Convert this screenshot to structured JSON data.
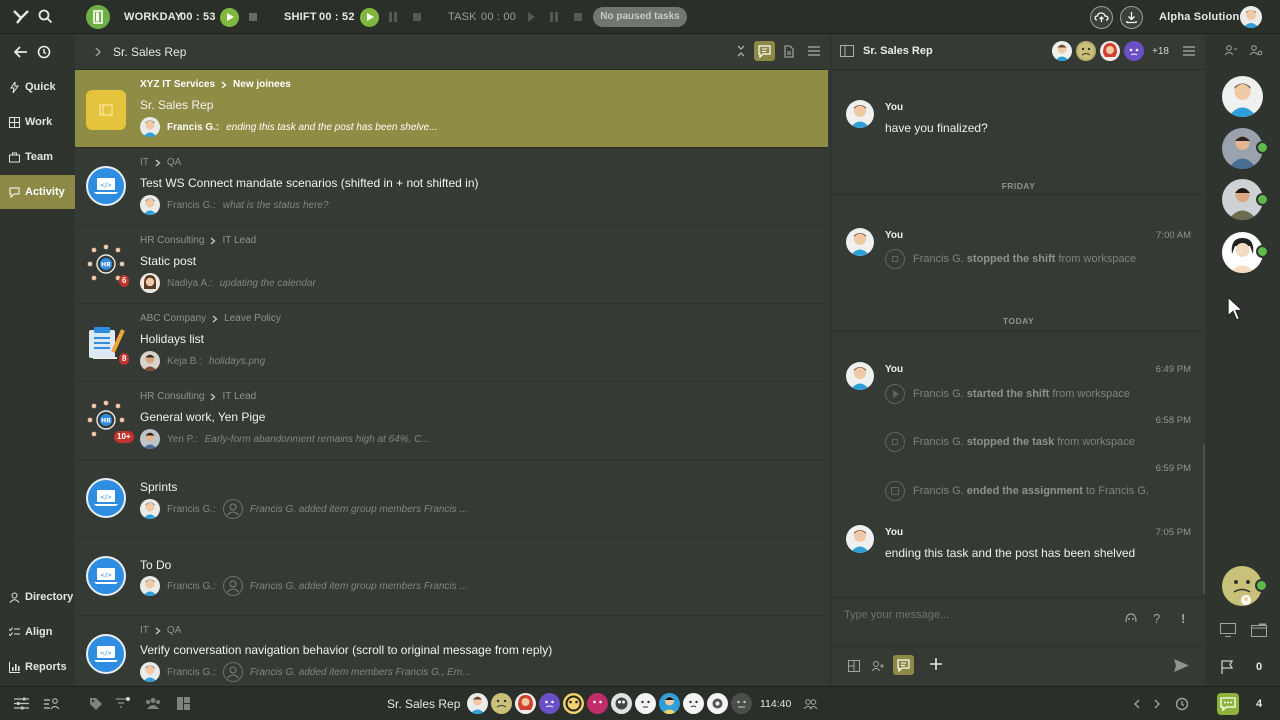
{
  "topbar": {
    "workday_label": "WORKDAY",
    "workday_time": "00 : 53",
    "shift_label": "SHIFT",
    "shift_time": "00 : 52",
    "task_label": "TASK",
    "task_time": "00 : 00",
    "paused_label": "No paused tasks",
    "org_name": "Alpha Solutions"
  },
  "nav": {
    "items": [
      {
        "label": "Quick",
        "icon": "lightning-icon"
      },
      {
        "label": "Work",
        "icon": "grid-icon"
      },
      {
        "label": "Team",
        "icon": "team-icon"
      },
      {
        "label": "Activity",
        "icon": "activity-icon"
      }
    ],
    "bottom_items": [
      {
        "label": "Directory",
        "icon": "directory-icon"
      },
      {
        "label": "Align",
        "icon": "align-icon"
      },
      {
        "label": "Reports",
        "icon": "reports-icon"
      }
    ]
  },
  "list": {
    "header_title": "Sr. Sales Rep",
    "rows": [
      {
        "bread": [
          "XYZ IT Services",
          "New joinees"
        ],
        "title": "Sr. Sales Rep",
        "author": "Francis G.:",
        "text": "ending this task and the post has been shelve...",
        "badge": ""
      },
      {
        "bread": [
          "IT",
          "QA"
        ],
        "title": "Test WS Connect mandate scenarios (shifted in + not shifted in)",
        "author": "Francis G.:",
        "text": "what is the status here?",
        "badge": ""
      },
      {
        "bread": [
          "HR Consulting",
          "IT Lead"
        ],
        "title": "Static post",
        "author": "Nadiya A.:",
        "text": "updating the calendar",
        "badge": "6"
      },
      {
        "bread": [
          "ABC Company",
          "Leave Policy"
        ],
        "title": "Holidays list",
        "author": "Keja B.:",
        "text": "holidays.png",
        "badge": "8"
      },
      {
        "bread": [
          "HR Consulting",
          "IT Lead"
        ],
        "title": "General work, Yen Pige",
        "author": "Yen P.:",
        "text": "Early-form abandonment remains high at 64%. C...",
        "badge": "10+"
      },
      {
        "bread": [],
        "title": "Sprints",
        "author": "Francis G.:",
        "text": "Francis G. added item group members Francis ...",
        "badge": ""
      },
      {
        "bread": [],
        "title": "To Do",
        "author": "Francis G.:",
        "text": "Francis G. added item group members Francis ...",
        "badge": ""
      },
      {
        "bread": [
          "IT",
          "QA"
        ],
        "title": "Verify conversation navigation behavior (scroll to original message from reply)",
        "author": "Francis G.:",
        "text": "Francis G. added item members Francis G., Em...",
        "badge": ""
      }
    ]
  },
  "chat": {
    "title": "Sr. Sales Rep",
    "member_extra": "+18",
    "you": "You",
    "msg1": "have you finalized?",
    "day_friday": "FRIDAY",
    "time_700": "7:00 AM",
    "sys1": {
      "who": "Francis G.",
      "action": "stopped the shift",
      "rest": "from workspace"
    },
    "day_today": "TODAY",
    "time_649": "6:49 PM",
    "sys2": {
      "who": "Francis G.",
      "action": "started the shift",
      "rest": "from workspace"
    },
    "time_658": "6:58 PM",
    "sys3": {
      "who": "Francis G.",
      "action": "stopped the task",
      "rest": "from workspace"
    },
    "time_659": "6:59 PM",
    "sys4": {
      "who": "Francis G.",
      "action": "ended the assignment",
      "rest": "to Francis G."
    },
    "time_705": "7:05 PM",
    "msg2": "ending this task and the post has been shelved",
    "input_placeholder": "Type your message...",
    "help": "?",
    "alert": "!"
  },
  "rail": {
    "flag_count": "0",
    "chat_count": "4"
  },
  "bottom": {
    "title": "Sr. Sales Rep",
    "time": "114:40"
  }
}
